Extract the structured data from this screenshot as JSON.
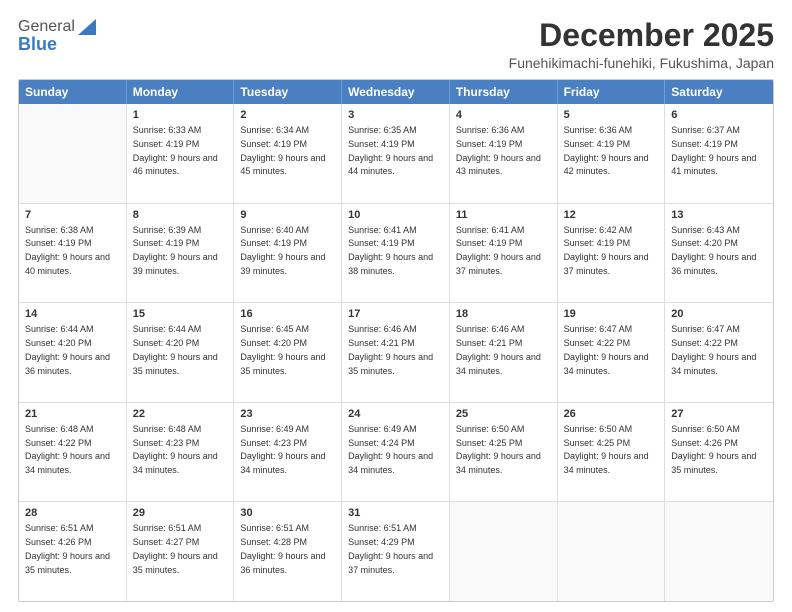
{
  "logo": {
    "general": "General",
    "blue": "Blue"
  },
  "title": "December 2025",
  "location": "Funehikimachi-funehiki, Fukushima, Japan",
  "weekdays": [
    "Sunday",
    "Monday",
    "Tuesday",
    "Wednesday",
    "Thursday",
    "Friday",
    "Saturday"
  ],
  "weeks": [
    [
      {
        "day": "",
        "sunrise": "",
        "sunset": "",
        "daylight": "",
        "empty": true
      },
      {
        "day": "1",
        "sunrise": "Sunrise: 6:33 AM",
        "sunset": "Sunset: 4:19 PM",
        "daylight": "Daylight: 9 hours and 46 minutes."
      },
      {
        "day": "2",
        "sunrise": "Sunrise: 6:34 AM",
        "sunset": "Sunset: 4:19 PM",
        "daylight": "Daylight: 9 hours and 45 minutes."
      },
      {
        "day": "3",
        "sunrise": "Sunrise: 6:35 AM",
        "sunset": "Sunset: 4:19 PM",
        "daylight": "Daylight: 9 hours and 44 minutes."
      },
      {
        "day": "4",
        "sunrise": "Sunrise: 6:36 AM",
        "sunset": "Sunset: 4:19 PM",
        "daylight": "Daylight: 9 hours and 43 minutes."
      },
      {
        "day": "5",
        "sunrise": "Sunrise: 6:36 AM",
        "sunset": "Sunset: 4:19 PM",
        "daylight": "Daylight: 9 hours and 42 minutes."
      },
      {
        "day": "6",
        "sunrise": "Sunrise: 6:37 AM",
        "sunset": "Sunset: 4:19 PM",
        "daylight": "Daylight: 9 hours and 41 minutes."
      }
    ],
    [
      {
        "day": "7",
        "sunrise": "Sunrise: 6:38 AM",
        "sunset": "Sunset: 4:19 PM",
        "daylight": "Daylight: 9 hours and 40 minutes."
      },
      {
        "day": "8",
        "sunrise": "Sunrise: 6:39 AM",
        "sunset": "Sunset: 4:19 PM",
        "daylight": "Daylight: 9 hours and 39 minutes."
      },
      {
        "day": "9",
        "sunrise": "Sunrise: 6:40 AM",
        "sunset": "Sunset: 4:19 PM",
        "daylight": "Daylight: 9 hours and 39 minutes."
      },
      {
        "day": "10",
        "sunrise": "Sunrise: 6:41 AM",
        "sunset": "Sunset: 4:19 PM",
        "daylight": "Daylight: 9 hours and 38 minutes."
      },
      {
        "day": "11",
        "sunrise": "Sunrise: 6:41 AM",
        "sunset": "Sunset: 4:19 PM",
        "daylight": "Daylight: 9 hours and 37 minutes."
      },
      {
        "day": "12",
        "sunrise": "Sunrise: 6:42 AM",
        "sunset": "Sunset: 4:19 PM",
        "daylight": "Daylight: 9 hours and 37 minutes."
      },
      {
        "day": "13",
        "sunrise": "Sunrise: 6:43 AM",
        "sunset": "Sunset: 4:20 PM",
        "daylight": "Daylight: 9 hours and 36 minutes."
      }
    ],
    [
      {
        "day": "14",
        "sunrise": "Sunrise: 6:44 AM",
        "sunset": "Sunset: 4:20 PM",
        "daylight": "Daylight: 9 hours and 36 minutes."
      },
      {
        "day": "15",
        "sunrise": "Sunrise: 6:44 AM",
        "sunset": "Sunset: 4:20 PM",
        "daylight": "Daylight: 9 hours and 35 minutes."
      },
      {
        "day": "16",
        "sunrise": "Sunrise: 6:45 AM",
        "sunset": "Sunset: 4:20 PM",
        "daylight": "Daylight: 9 hours and 35 minutes."
      },
      {
        "day": "17",
        "sunrise": "Sunrise: 6:46 AM",
        "sunset": "Sunset: 4:21 PM",
        "daylight": "Daylight: 9 hours and 35 minutes."
      },
      {
        "day": "18",
        "sunrise": "Sunrise: 6:46 AM",
        "sunset": "Sunset: 4:21 PM",
        "daylight": "Daylight: 9 hours and 34 minutes."
      },
      {
        "day": "19",
        "sunrise": "Sunrise: 6:47 AM",
        "sunset": "Sunset: 4:22 PM",
        "daylight": "Daylight: 9 hours and 34 minutes."
      },
      {
        "day": "20",
        "sunrise": "Sunrise: 6:47 AM",
        "sunset": "Sunset: 4:22 PM",
        "daylight": "Daylight: 9 hours and 34 minutes."
      }
    ],
    [
      {
        "day": "21",
        "sunrise": "Sunrise: 6:48 AM",
        "sunset": "Sunset: 4:22 PM",
        "daylight": "Daylight: 9 hours and 34 minutes."
      },
      {
        "day": "22",
        "sunrise": "Sunrise: 6:48 AM",
        "sunset": "Sunset: 4:23 PM",
        "daylight": "Daylight: 9 hours and 34 minutes."
      },
      {
        "day": "23",
        "sunrise": "Sunrise: 6:49 AM",
        "sunset": "Sunset: 4:23 PM",
        "daylight": "Daylight: 9 hours and 34 minutes."
      },
      {
        "day": "24",
        "sunrise": "Sunrise: 6:49 AM",
        "sunset": "Sunset: 4:24 PM",
        "daylight": "Daylight: 9 hours and 34 minutes."
      },
      {
        "day": "25",
        "sunrise": "Sunrise: 6:50 AM",
        "sunset": "Sunset: 4:25 PM",
        "daylight": "Daylight: 9 hours and 34 minutes."
      },
      {
        "day": "26",
        "sunrise": "Sunrise: 6:50 AM",
        "sunset": "Sunset: 4:25 PM",
        "daylight": "Daylight: 9 hours and 34 minutes."
      },
      {
        "day": "27",
        "sunrise": "Sunrise: 6:50 AM",
        "sunset": "Sunset: 4:26 PM",
        "daylight": "Daylight: 9 hours and 35 minutes."
      }
    ],
    [
      {
        "day": "28",
        "sunrise": "Sunrise: 6:51 AM",
        "sunset": "Sunset: 4:26 PM",
        "daylight": "Daylight: 9 hours and 35 minutes."
      },
      {
        "day": "29",
        "sunrise": "Sunrise: 6:51 AM",
        "sunset": "Sunset: 4:27 PM",
        "daylight": "Daylight: 9 hours and 35 minutes."
      },
      {
        "day": "30",
        "sunrise": "Sunrise: 6:51 AM",
        "sunset": "Sunset: 4:28 PM",
        "daylight": "Daylight: 9 hours and 36 minutes."
      },
      {
        "day": "31",
        "sunrise": "Sunrise: 6:51 AM",
        "sunset": "Sunset: 4:29 PM",
        "daylight": "Daylight: 9 hours and 37 minutes."
      },
      {
        "day": "",
        "sunrise": "",
        "sunset": "",
        "daylight": "",
        "empty": true
      },
      {
        "day": "",
        "sunrise": "",
        "sunset": "",
        "daylight": "",
        "empty": true
      },
      {
        "day": "",
        "sunrise": "",
        "sunset": "",
        "daylight": "",
        "empty": true
      }
    ]
  ]
}
